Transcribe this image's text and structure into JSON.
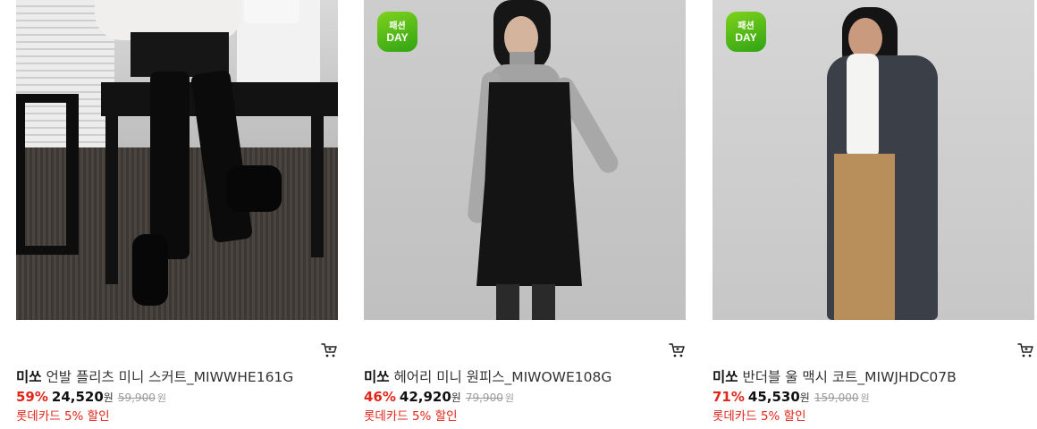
{
  "colors": {
    "discount": "#e0261a",
    "badge_green": "#4cb81a",
    "text": "#222222",
    "muted": "#9a9a9a"
  },
  "products": [
    {
      "brand": "미쏘",
      "name": "언발 플리츠 미니 스커트_MIWWHE161G",
      "discount": "59%",
      "price": "24,520",
      "unit": "원",
      "original_price": "59,900",
      "original_unit": "원",
      "promo": "롯데카드 5% 할인",
      "badge": null,
      "cart_icon": "shopping-cart-icon"
    },
    {
      "brand": "미쏘",
      "name": "헤어리 미니 원피스_MIWOWE108G",
      "discount": "46%",
      "price": "42,920",
      "unit": "원",
      "original_price": "79,900",
      "original_unit": "원",
      "promo": "롯데카드 5% 할인",
      "badge": {
        "line1": "패션",
        "line2": "DAY"
      },
      "cart_icon": "shopping-cart-icon"
    },
    {
      "brand": "미쏘",
      "name": "반더블 울 맥시 코트_MIWJHDC07B",
      "discount": "71%",
      "price": "45,530",
      "unit": "원",
      "original_price": "159,000",
      "original_unit": "원",
      "promo": "롯데카드 5% 할인",
      "badge": {
        "line1": "패션",
        "line2": "DAY"
      },
      "cart_icon": "shopping-cart-icon"
    }
  ]
}
